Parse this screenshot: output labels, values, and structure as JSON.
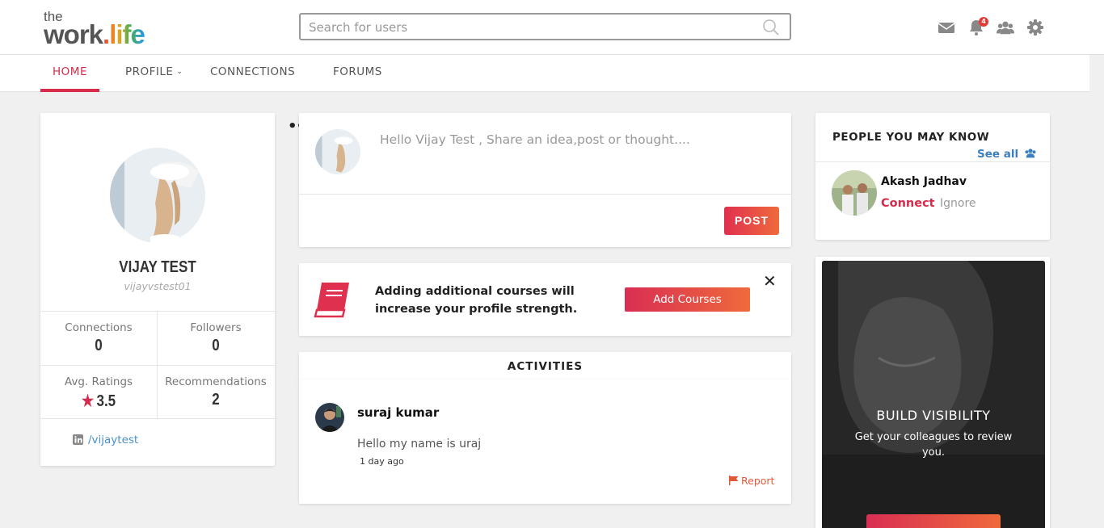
{
  "header": {
    "logo_top": "the",
    "logo_work": "work",
    "logo_life": ".life",
    "search": {
      "placeholder": "Search for users"
    },
    "notification_count": "4"
  },
  "nav": {
    "tabs": [
      {
        "label": "HOME",
        "active": true
      },
      {
        "label": "PROFILE",
        "dropdown": true
      },
      {
        "label": "CONNECTIONS"
      },
      {
        "label": "FORUMS"
      }
    ]
  },
  "profile": {
    "name": "VIJAY TEST",
    "username": "vijayvstest01",
    "stats": {
      "connections_label": "Connections",
      "connections_value": "0",
      "followers_label": "Followers",
      "followers_value": "0",
      "ratings_label": "Avg. Ratings",
      "ratings_value": "3.5",
      "recommendations_label": "Recommendations",
      "recommendations_value": "2"
    },
    "linkedin": "/vijaytest"
  },
  "composer": {
    "placeholder": "Hello Vijay Test , Share an idea,post or thought....",
    "post_label": "POST"
  },
  "courses_banner": {
    "text": "Adding additional courses will increase your profile strength.",
    "button_label": "Add Courses"
  },
  "activities": {
    "title": "ACTIVITIES",
    "items": [
      {
        "user": "suraj kumar",
        "text": "Hello my name is uraj",
        "time": "1 day ago",
        "report_label": "Report"
      }
    ]
  },
  "people": {
    "title": "PEOPLE YOU MAY KNOW",
    "see_all": "See all",
    "suggestions": [
      {
        "name": "Akash Jadhav",
        "connect_label": "Connect",
        "ignore_label": "Ignore"
      }
    ]
  },
  "promo": {
    "title": "BUILD VISIBILITY",
    "subtitle": "Get your colleagues to review you."
  },
  "colors": {
    "accent": "#d62b4b",
    "link": "#3b7fbf",
    "report": "#e05a3a"
  }
}
